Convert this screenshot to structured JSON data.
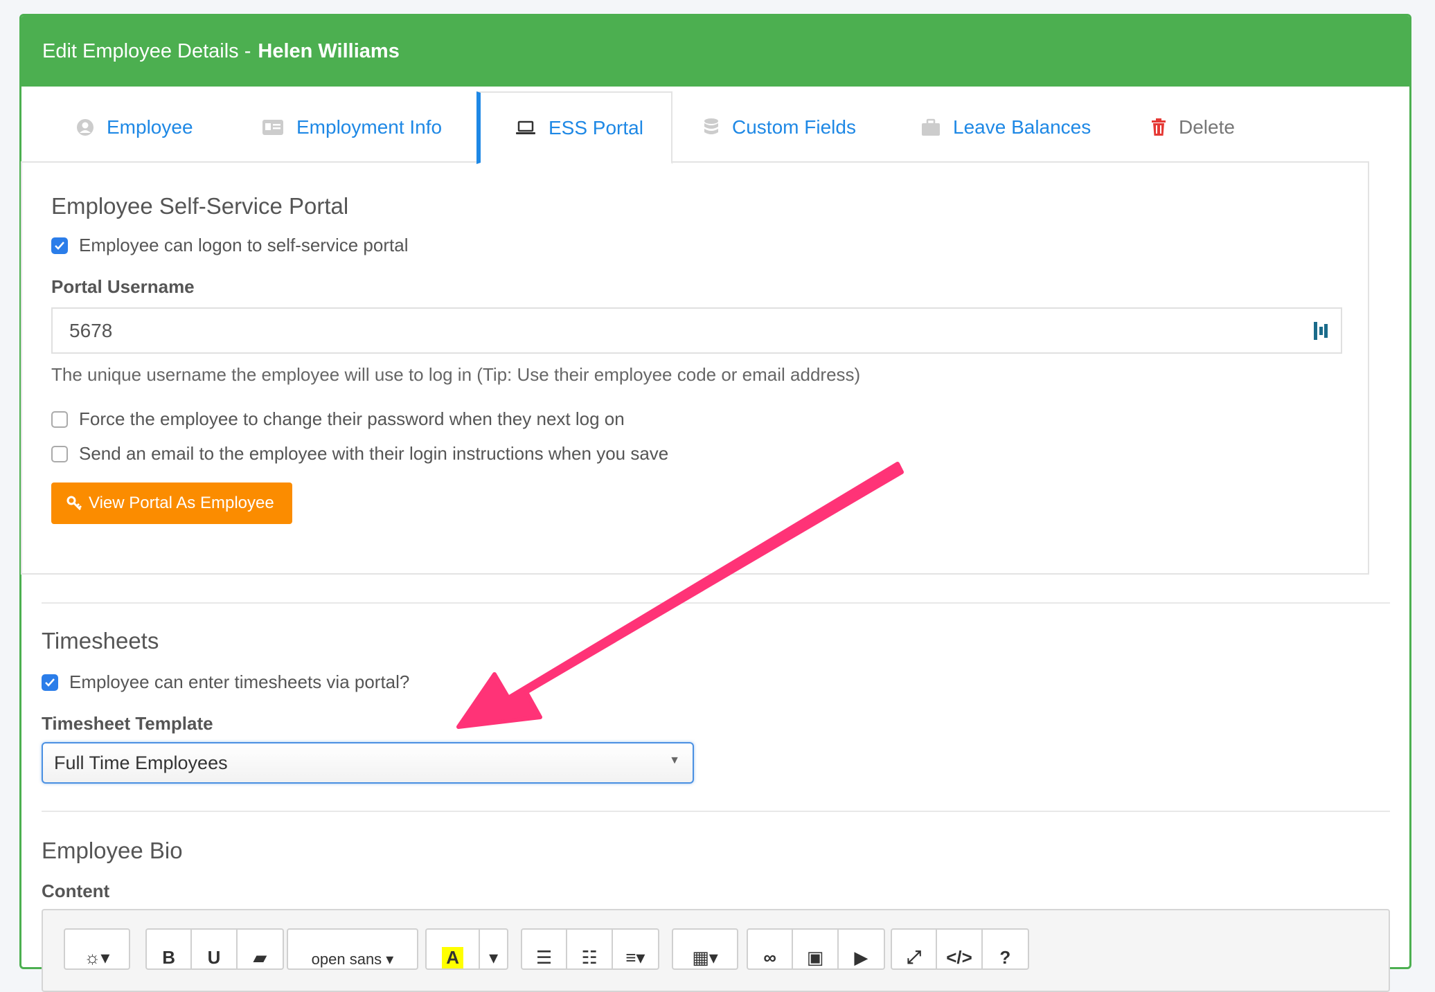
{
  "header": {
    "prefix": "Edit Employee Details - ",
    "employee_name": "Helen Williams"
  },
  "tabs": [
    {
      "label": "Employee"
    },
    {
      "label": "Employment Info"
    },
    {
      "label": "ESS Portal"
    },
    {
      "label": "Custom Fields"
    },
    {
      "label": "Leave Balances"
    },
    {
      "label": "Delete"
    }
  ],
  "ess": {
    "title": "Employee Self-Service Portal",
    "can_logon_label": "Employee can logon to self-service portal",
    "can_logon_checked": true,
    "username_label": "Portal Username",
    "username_value": "5678",
    "username_help": "The unique username the employee will use to log in (Tip: Use their employee code or email address)",
    "force_change_label": "Force the employee to change their password when they next log on",
    "send_email_label": "Send an email to the employee with their login instructions when you save",
    "view_portal_button": "View Portal As Employee"
  },
  "timesheets": {
    "title": "Timesheets",
    "enter_via_portal_label": "Employee can enter timesheets via portal?",
    "enter_via_portal_checked": true,
    "template_label": "Timesheet Template",
    "template_selected": "Full Time Employees"
  },
  "bio": {
    "title": "Employee Bio",
    "content_label": "Content",
    "toolbar": {
      "bold": "B",
      "underline": "U",
      "font_name": "open sans",
      "help": "?"
    }
  },
  "colors": {
    "header_green": "#4caf50",
    "tab_blue": "#1e88e5",
    "button_orange": "#fb8c00",
    "checkbox_blue": "#2b7de9",
    "annotation_arrow": "#ff3377",
    "delete_red": "#e53935"
  }
}
